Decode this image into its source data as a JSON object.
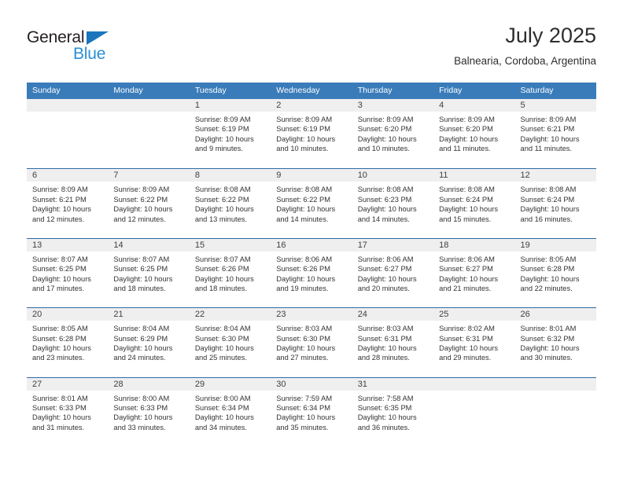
{
  "brand": {
    "name_part1": "General",
    "name_part2": "Blue",
    "triangle_color": "#1b75bc",
    "blue_color": "#2a8fd4"
  },
  "header": {
    "month_title": "July 2025",
    "location": "Balnearia, Cordoba, Argentina"
  },
  "theme": {
    "header_bar": "#3a7cba",
    "row_divider": "#2d6ba3",
    "band": "#efefef"
  },
  "weekdays": [
    "Sunday",
    "Monday",
    "Tuesday",
    "Wednesday",
    "Thursday",
    "Friday",
    "Saturday"
  ],
  "weeks": [
    {
      "days": [
        {
          "num": "",
          "lines": []
        },
        {
          "num": "",
          "lines": []
        },
        {
          "num": "1",
          "lines": [
            "Sunrise: 8:09 AM",
            "Sunset: 6:19 PM",
            "Daylight: 10 hours",
            "and 9 minutes."
          ]
        },
        {
          "num": "2",
          "lines": [
            "Sunrise: 8:09 AM",
            "Sunset: 6:19 PM",
            "Daylight: 10 hours",
            "and 10 minutes."
          ]
        },
        {
          "num": "3",
          "lines": [
            "Sunrise: 8:09 AM",
            "Sunset: 6:20 PM",
            "Daylight: 10 hours",
            "and 10 minutes."
          ]
        },
        {
          "num": "4",
          "lines": [
            "Sunrise: 8:09 AM",
            "Sunset: 6:20 PM",
            "Daylight: 10 hours",
            "and 11 minutes."
          ]
        },
        {
          "num": "5",
          "lines": [
            "Sunrise: 8:09 AM",
            "Sunset: 6:21 PM",
            "Daylight: 10 hours",
            "and 11 minutes."
          ]
        }
      ]
    },
    {
      "days": [
        {
          "num": "6",
          "lines": [
            "Sunrise: 8:09 AM",
            "Sunset: 6:21 PM",
            "Daylight: 10 hours",
            "and 12 minutes."
          ]
        },
        {
          "num": "7",
          "lines": [
            "Sunrise: 8:09 AM",
            "Sunset: 6:22 PM",
            "Daylight: 10 hours",
            "and 12 minutes."
          ]
        },
        {
          "num": "8",
          "lines": [
            "Sunrise: 8:08 AM",
            "Sunset: 6:22 PM",
            "Daylight: 10 hours",
            "and 13 minutes."
          ]
        },
        {
          "num": "9",
          "lines": [
            "Sunrise: 8:08 AM",
            "Sunset: 6:22 PM",
            "Daylight: 10 hours",
            "and 14 minutes."
          ]
        },
        {
          "num": "10",
          "lines": [
            "Sunrise: 8:08 AM",
            "Sunset: 6:23 PM",
            "Daylight: 10 hours",
            "and 14 minutes."
          ]
        },
        {
          "num": "11",
          "lines": [
            "Sunrise: 8:08 AM",
            "Sunset: 6:24 PM",
            "Daylight: 10 hours",
            "and 15 minutes."
          ]
        },
        {
          "num": "12",
          "lines": [
            "Sunrise: 8:08 AM",
            "Sunset: 6:24 PM",
            "Daylight: 10 hours",
            "and 16 minutes."
          ]
        }
      ]
    },
    {
      "days": [
        {
          "num": "13",
          "lines": [
            "Sunrise: 8:07 AM",
            "Sunset: 6:25 PM",
            "Daylight: 10 hours",
            "and 17 minutes."
          ]
        },
        {
          "num": "14",
          "lines": [
            "Sunrise: 8:07 AM",
            "Sunset: 6:25 PM",
            "Daylight: 10 hours",
            "and 18 minutes."
          ]
        },
        {
          "num": "15",
          "lines": [
            "Sunrise: 8:07 AM",
            "Sunset: 6:26 PM",
            "Daylight: 10 hours",
            "and 18 minutes."
          ]
        },
        {
          "num": "16",
          "lines": [
            "Sunrise: 8:06 AM",
            "Sunset: 6:26 PM",
            "Daylight: 10 hours",
            "and 19 minutes."
          ]
        },
        {
          "num": "17",
          "lines": [
            "Sunrise: 8:06 AM",
            "Sunset: 6:27 PM",
            "Daylight: 10 hours",
            "and 20 minutes."
          ]
        },
        {
          "num": "18",
          "lines": [
            "Sunrise: 8:06 AM",
            "Sunset: 6:27 PM",
            "Daylight: 10 hours",
            "and 21 minutes."
          ]
        },
        {
          "num": "19",
          "lines": [
            "Sunrise: 8:05 AM",
            "Sunset: 6:28 PM",
            "Daylight: 10 hours",
            "and 22 minutes."
          ]
        }
      ]
    },
    {
      "days": [
        {
          "num": "20",
          "lines": [
            "Sunrise: 8:05 AM",
            "Sunset: 6:28 PM",
            "Daylight: 10 hours",
            "and 23 minutes."
          ]
        },
        {
          "num": "21",
          "lines": [
            "Sunrise: 8:04 AM",
            "Sunset: 6:29 PM",
            "Daylight: 10 hours",
            "and 24 minutes."
          ]
        },
        {
          "num": "22",
          "lines": [
            "Sunrise: 8:04 AM",
            "Sunset: 6:30 PM",
            "Daylight: 10 hours",
            "and 25 minutes."
          ]
        },
        {
          "num": "23",
          "lines": [
            "Sunrise: 8:03 AM",
            "Sunset: 6:30 PM",
            "Daylight: 10 hours",
            "and 27 minutes."
          ]
        },
        {
          "num": "24",
          "lines": [
            "Sunrise: 8:03 AM",
            "Sunset: 6:31 PM",
            "Daylight: 10 hours",
            "and 28 minutes."
          ]
        },
        {
          "num": "25",
          "lines": [
            "Sunrise: 8:02 AM",
            "Sunset: 6:31 PM",
            "Daylight: 10 hours",
            "and 29 minutes."
          ]
        },
        {
          "num": "26",
          "lines": [
            "Sunrise: 8:01 AM",
            "Sunset: 6:32 PM",
            "Daylight: 10 hours",
            "and 30 minutes."
          ]
        }
      ]
    },
    {
      "days": [
        {
          "num": "27",
          "lines": [
            "Sunrise: 8:01 AM",
            "Sunset: 6:33 PM",
            "Daylight: 10 hours",
            "and 31 minutes."
          ]
        },
        {
          "num": "28",
          "lines": [
            "Sunrise: 8:00 AM",
            "Sunset: 6:33 PM",
            "Daylight: 10 hours",
            "and 33 minutes."
          ]
        },
        {
          "num": "29",
          "lines": [
            "Sunrise: 8:00 AM",
            "Sunset: 6:34 PM",
            "Daylight: 10 hours",
            "and 34 minutes."
          ]
        },
        {
          "num": "30",
          "lines": [
            "Sunrise: 7:59 AM",
            "Sunset: 6:34 PM",
            "Daylight: 10 hours",
            "and 35 minutes."
          ]
        },
        {
          "num": "31",
          "lines": [
            "Sunrise: 7:58 AM",
            "Sunset: 6:35 PM",
            "Daylight: 10 hours",
            "and 36 minutes."
          ]
        },
        {
          "num": "",
          "lines": []
        },
        {
          "num": "",
          "lines": []
        }
      ]
    }
  ]
}
